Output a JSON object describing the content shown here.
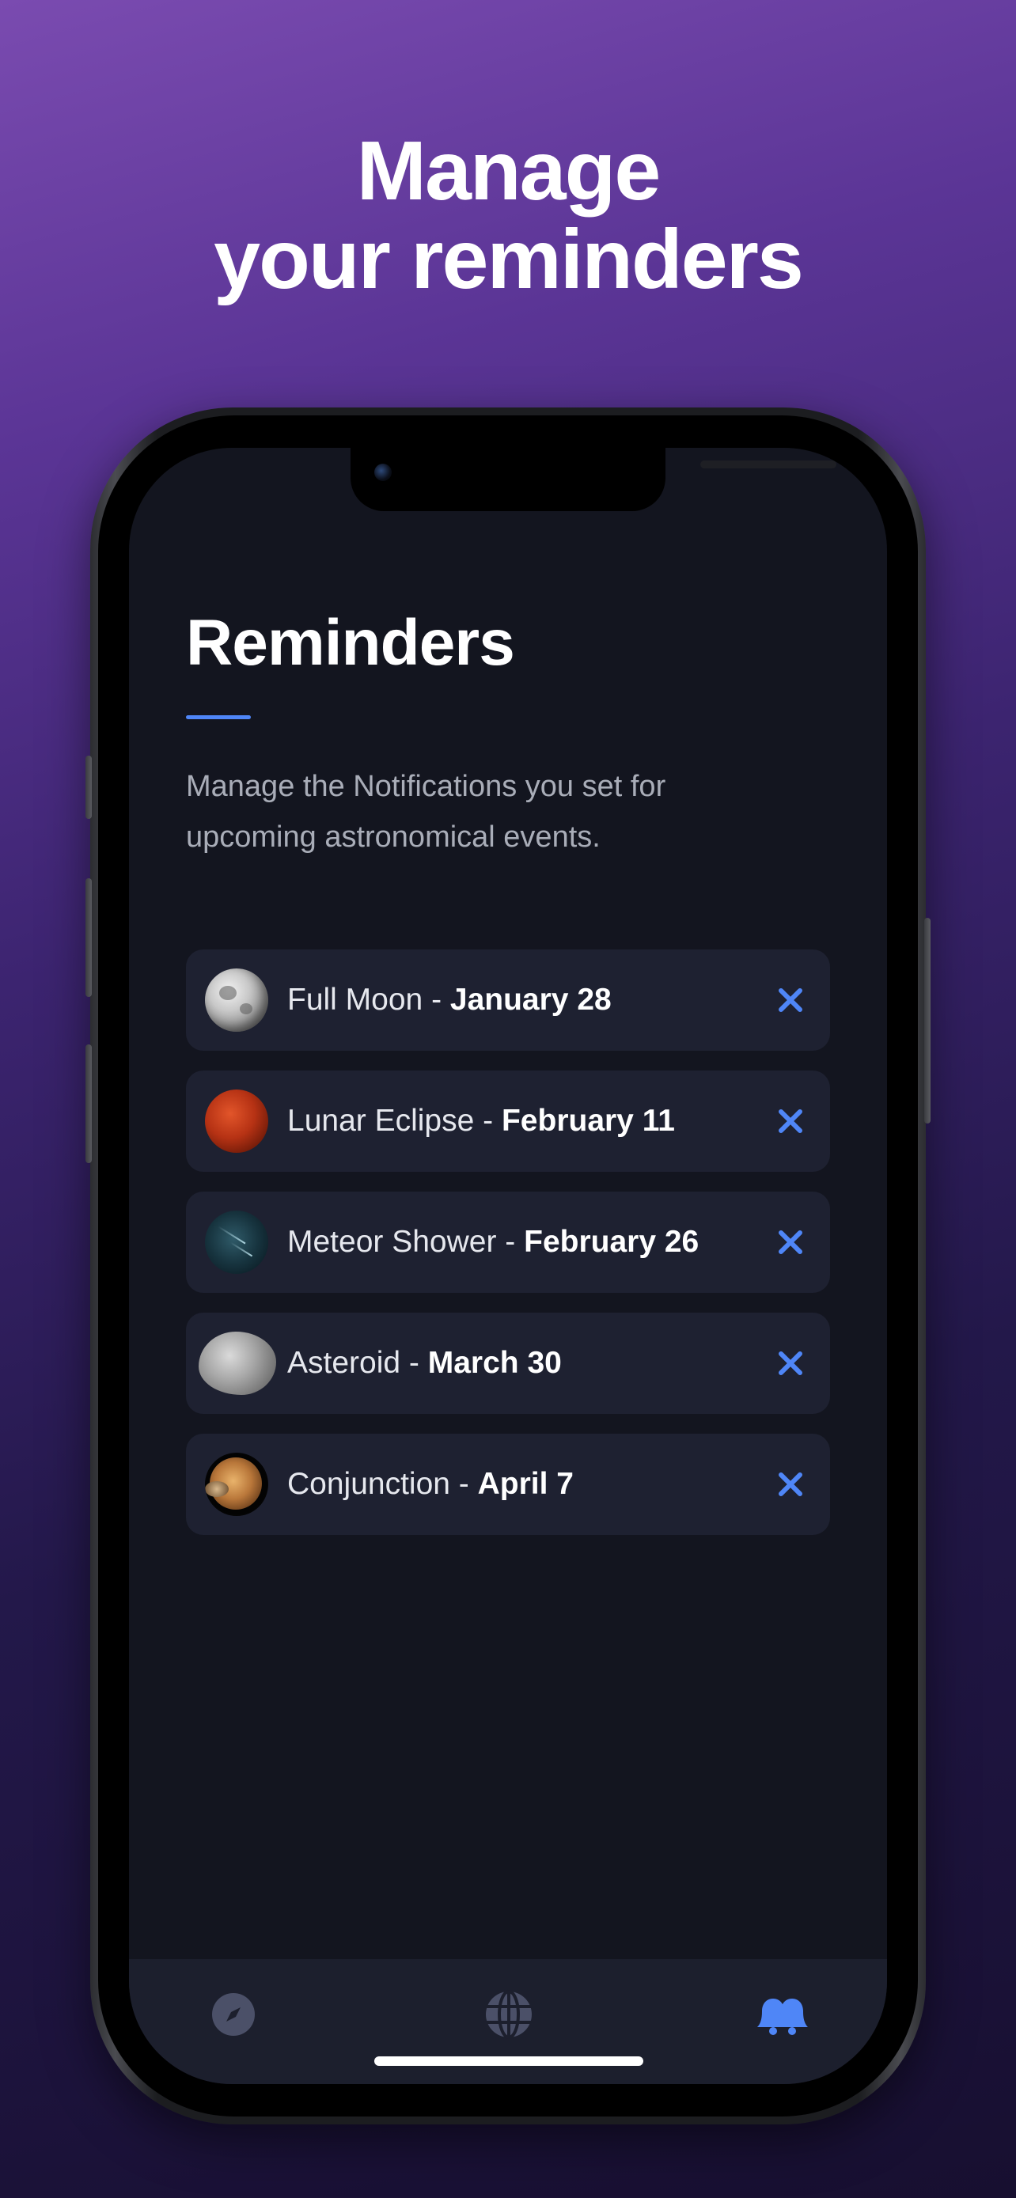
{
  "headline": {
    "line1": "Manage",
    "line2": "your reminders"
  },
  "screen": {
    "title": "Reminders",
    "subtitle": "Manage the Notifications you set for upcoming astronomical events.",
    "reminders": [
      {
        "event": "Full Moon",
        "separator": " - ",
        "date": "January 28",
        "thumbnail": "full-moon"
      },
      {
        "event": "Lunar Eclipse",
        "separator": " - ",
        "date": "February 11",
        "thumbnail": "lunar-eclipse"
      },
      {
        "event": "Meteor Shower",
        "separator": " - ",
        "date": "February 26",
        "thumbnail": "meteor-shower"
      },
      {
        "event": "Asteroid",
        "separator": " - ",
        "date": "March 30",
        "thumbnail": "asteroid"
      },
      {
        "event": "Conjunction",
        "separator": " - ",
        "date": "April 7",
        "thumbnail": "conjunction"
      }
    ],
    "remove_icon": "close-icon",
    "tabbar": {
      "tabs": [
        {
          "icon": "compass-icon",
          "active": false
        },
        {
          "icon": "globe-icon",
          "active": false
        },
        {
          "icon": "bells-icon",
          "active": true
        }
      ]
    }
  },
  "colors": {
    "accent": "#4f86f7",
    "screen_background": "#13151f",
    "card_background": "#1e2131",
    "tabbar_background": "#1c1f2d",
    "inactive_icon": "#4b5068",
    "page_gradient_top": "#7a4bb0",
    "page_gradient_bottom": "#170f30"
  }
}
